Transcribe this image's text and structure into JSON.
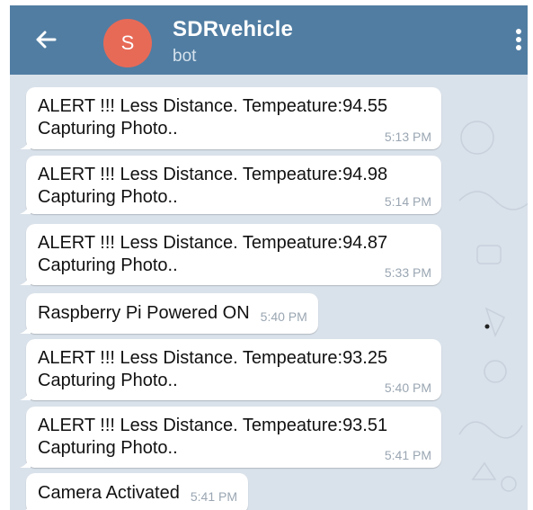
{
  "header": {
    "avatar_letter": "S",
    "title": "SDRvehicle",
    "subtitle": "bot",
    "back_icon": "arrow-left-icon",
    "menu_icon": "more-vertical-icon",
    "colors": {
      "bar": "#517da2",
      "avatar": "#e76a57",
      "chat_bg": "#d9e1ea"
    }
  },
  "messages": [
    {
      "line1": "ALERT !!! Less Distance. Tempeature:94.55",
      "line2": "Capturing Photo..",
      "time": "5:13 PM"
    },
    {
      "line1": "ALERT !!! Less Distance. Tempeature:94.98",
      "line2": "Capturing Photo..",
      "time": "5:14 PM"
    },
    {
      "line1": "ALERT !!! Less Distance. Tempeature:94.87",
      "line2": "Capturing Photo..",
      "time": "5:33 PM"
    },
    {
      "line1": "Raspberry Pi Powered ON",
      "time": "5:40 PM"
    },
    {
      "line1": "ALERT !!! Less Distance. Tempeature:93.25",
      "line2": "Capturing Photo..",
      "time": "5:40 PM"
    },
    {
      "line1": "ALERT !!! Less Distance. Tempeature:93.51",
      "line2": "Capturing Photo..",
      "time": "5:41 PM"
    },
    {
      "line1": "Camera Activated",
      "time": "5:41 PM"
    }
  ]
}
